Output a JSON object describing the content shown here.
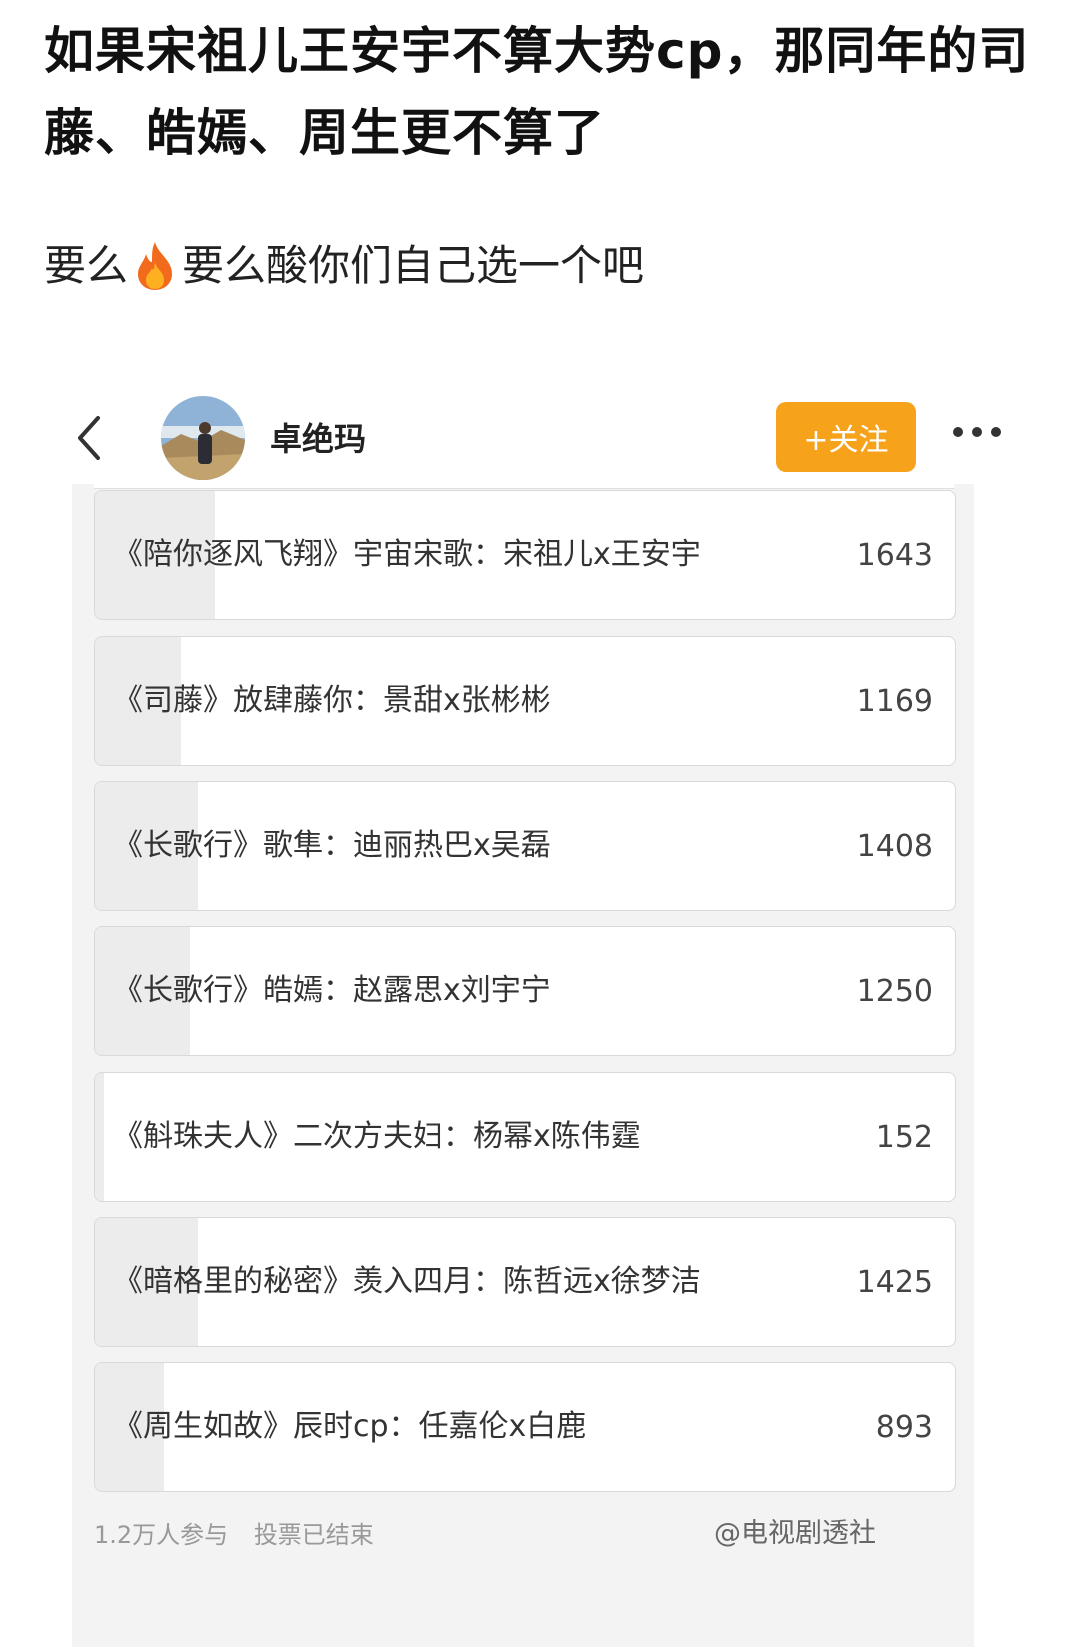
{
  "post": {
    "title": "如果宋祖儿王安宇不算大势cp，那同年的司藤、皓嫣、周生更不算了",
    "body_before": "要么",
    "body_icon": "fire-emoji",
    "body_after": "要么酸你们自己选一个吧"
  },
  "profile_bar": {
    "back_icon": "chevron-left-icon",
    "username": "卓绝玛",
    "follow_label": "+关注",
    "more_icon": "more-dots-icon"
  },
  "poll": {
    "options": [
      {
        "label": "《陪你逐风飞翔》宇宙宋歌：宋祖儿x王安宇",
        "votes": "1643",
        "fill": 0.14
      },
      {
        "label": "《司藤》放肆藤你：景甜x张彬彬",
        "votes": "1169",
        "fill": 0.1
      },
      {
        "label": "《长歌行》歌隼：迪丽热巴x吴磊",
        "votes": "1408",
        "fill": 0.12
      },
      {
        "label": "《长歌行》皓嫣：赵露思x刘宇宁",
        "votes": "1250",
        "fill": 0.11
      },
      {
        "label": "《斛珠夫人》二次方夫妇：杨幂x陈伟霆",
        "votes": "152",
        "fill": 0.01
      },
      {
        "label": "《暗格里的秘密》羡入四月：陈哲远x徐梦洁",
        "votes": "1425",
        "fill": 0.12
      },
      {
        "label": "《周生如故》辰时cp：任嘉伦x白鹿",
        "votes": "893",
        "fill": 0.08
      }
    ],
    "participants": "1.2万人参与",
    "status": "投票已结束",
    "source": "@电视剧透社"
  },
  "colors": {
    "follow_button": "#f7a21b",
    "poll_background": "#f3f3f3",
    "option_fill": "#ececec"
  }
}
